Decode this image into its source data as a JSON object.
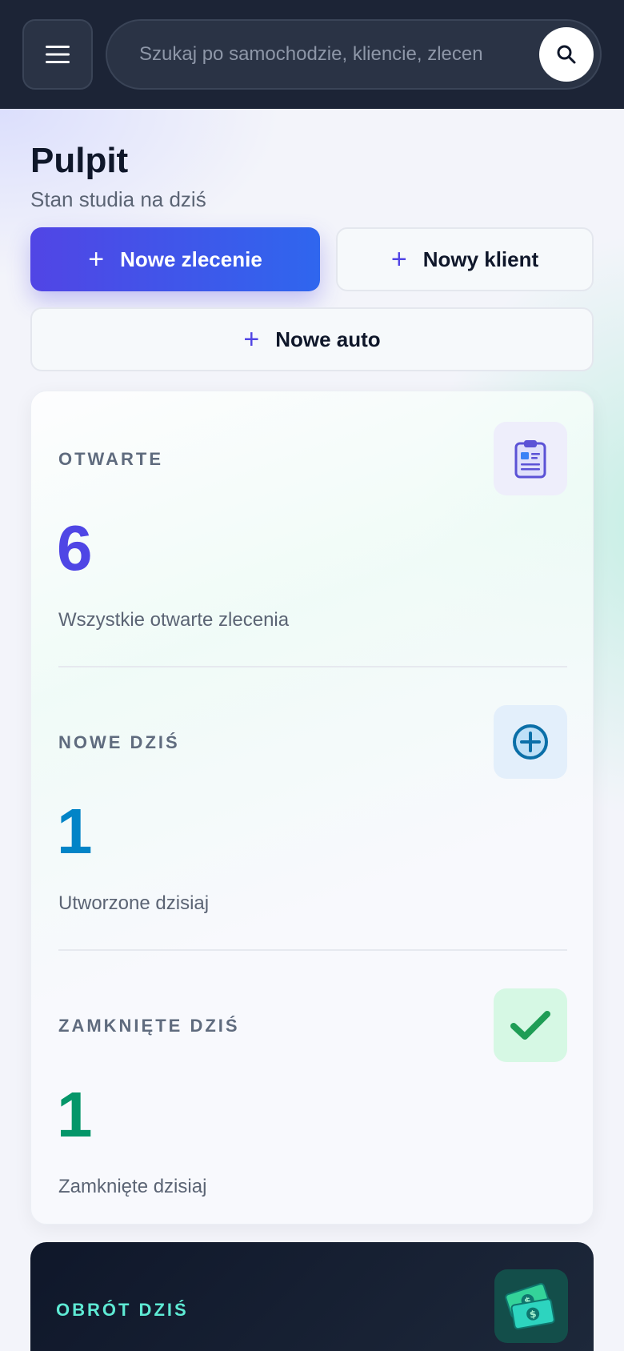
{
  "header": {
    "search_placeholder": "Szukaj po samochodzie, kliencie, zlecen"
  },
  "page": {
    "title": "Pulpit",
    "subtitle": "Stan studia na dziś"
  },
  "actions": {
    "new_order": "Nowe zlecenie",
    "new_client": "Nowy klient",
    "new_car": "Nowe auto",
    "plus_glyph": "+"
  },
  "stats": [
    {
      "label": "OTWARTE",
      "value": "6",
      "description": "Wszystkie otwarte zlecenia",
      "color": "#4f46e5"
    },
    {
      "label": "NOWE DZIŚ",
      "value": "1",
      "description": "Utworzone dzisiaj",
      "color": "#0284c7"
    },
    {
      "label": "ZAMKNIĘTE DZIŚ",
      "value": "1",
      "description": "Zamknięte dzisiaj",
      "color": "#059669"
    }
  ],
  "revenue": {
    "label": "OBRÓT DZIŚ"
  },
  "colors": {
    "topbar": "#1c2436",
    "primary": "#4f46e5",
    "accent_teal": "#5eead4"
  }
}
